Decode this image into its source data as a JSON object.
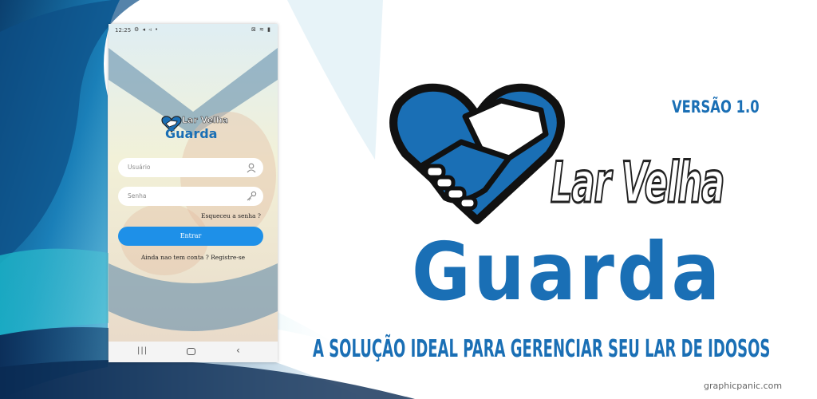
{
  "phone": {
    "status": {
      "time": "12:25",
      "apps": "⚙ ◂ ◃ •",
      "right": "⊠ ≋ ▮"
    },
    "logo": {
      "line1": "Lar Velha",
      "line2": "Guarda"
    },
    "username_placeholder": "Usuário",
    "password_placeholder": "Senha",
    "forgot_label": "Esqueceu a senha ?",
    "login_label": "Entrar",
    "register_label": "Ainda nao tem conta ? Registre-se",
    "nav": {
      "recents": "|||",
      "back": "‹"
    },
    "icons": {
      "user": "user-icon",
      "key": "key-icon"
    }
  },
  "brand": {
    "line1": "Lar Velha",
    "line2": "Guarda",
    "version": "VERSÃO 1.0",
    "tagline": "A SOLUÇÃO IDEAL PARA GERENCIAR SEU LAR DE IDOSOS",
    "watermark": "graphicpanic.com"
  },
  "colors": {
    "brand_blue": "#1a6fb5",
    "button_blue": "#1e90e8",
    "outline": "#222222"
  }
}
